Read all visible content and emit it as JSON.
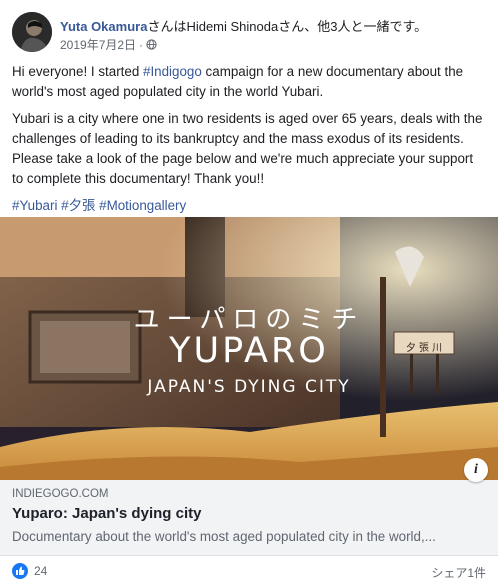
{
  "author": {
    "name": "Yuta Okamura",
    "with_text": "さんはHidemi Shinodaさん、他3人と一緒です。",
    "date": "2019年7月2日",
    "separator": "·"
  },
  "post": {
    "paragraph1_start": "Hi everyone! I started ",
    "paragraph1_tag": "#Indigogo",
    "paragraph1_end": " campaign for a new documentary about the world's most aged populated city in the world Yubari.",
    "paragraph2": "Yubari is a city where one in two residents is aged over 65 years, deals with the challenges of leading to its bankruptcy and the mass exodus of its residents. Please take a look of the page below and we're much appreciate your support to complete this documentary! Thank you!!",
    "hashtags": [
      "#Yubari",
      "#夕張",
      "#Motiongallery"
    ]
  },
  "link_preview": {
    "image_title_jp": "ユーパロのミチ",
    "image_title": "YUPARO",
    "image_subtitle": "JAPAN'S DYING CITY",
    "sign_text": "夕 張 川",
    "info_label": "i",
    "domain": "INDIEGOGO.COM",
    "title": "Yuparo: Japan's dying city",
    "description": "Documentary about the world's most aged populated city in the world,..."
  },
  "footer": {
    "like_count": "24",
    "share_text": "シェア1件"
  },
  "colors": {
    "link_blue": "#385898",
    "like_blue": "#1877f2",
    "preview_bg": "#f2f3f5"
  }
}
